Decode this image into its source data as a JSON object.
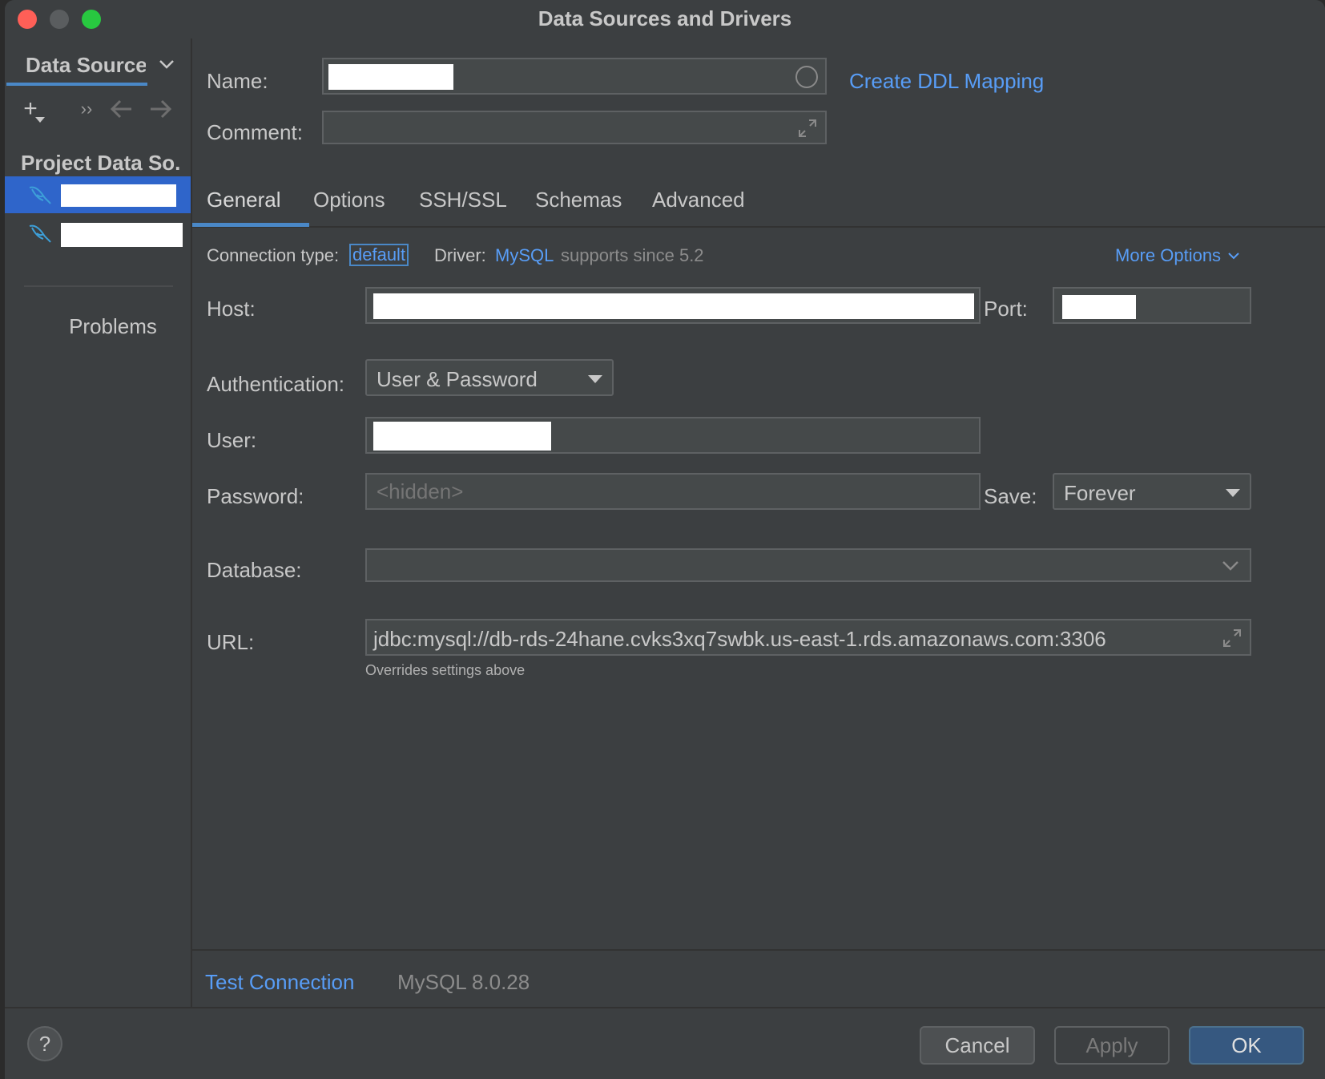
{
  "window": {
    "title": "Data Sources and Drivers"
  },
  "sidebar": {
    "header": "Data Source",
    "section_title": "Project Data So.",
    "problems_label": "Problems"
  },
  "form": {
    "name_label": "Name:",
    "comment_label": "Comment:",
    "create_ddl_link": "Create DDL Mapping"
  },
  "tabs": [
    {
      "label": "General"
    },
    {
      "label": "Options"
    },
    {
      "label": "SSH/SSL"
    },
    {
      "label": "Schemas"
    },
    {
      "label": "Advanced"
    }
  ],
  "general": {
    "connection_type_label": "Connection type:",
    "connection_type_value": "default",
    "driver_label": "Driver:",
    "driver_value": "MySQL",
    "driver_note": "supports since 5.2",
    "more_options": "More Options",
    "host_label": "Host:",
    "port_label": "Port:",
    "auth_label": "Authentication:",
    "auth_value": "User & Password",
    "user_label": "User:",
    "password_label": "Password:",
    "password_placeholder": "<hidden>",
    "save_label": "Save:",
    "save_value": "Forever",
    "database_label": "Database:",
    "url_label": "URL:",
    "url_value": "jdbc:mysql://db-rds-24hane.cvks3xq7swbk.us-east-1.rds.amazonaws.com:3306",
    "url_hint": "Overrides settings above"
  },
  "status": {
    "test_connection": "Test Connection",
    "server_version": "MySQL 8.0.28"
  },
  "footer": {
    "help": "?",
    "cancel": "Cancel",
    "apply": "Apply",
    "ok": "OK"
  },
  "colors": {
    "accent": "#589df6",
    "selection": "#2f65ca",
    "background": "#3c3f41"
  }
}
